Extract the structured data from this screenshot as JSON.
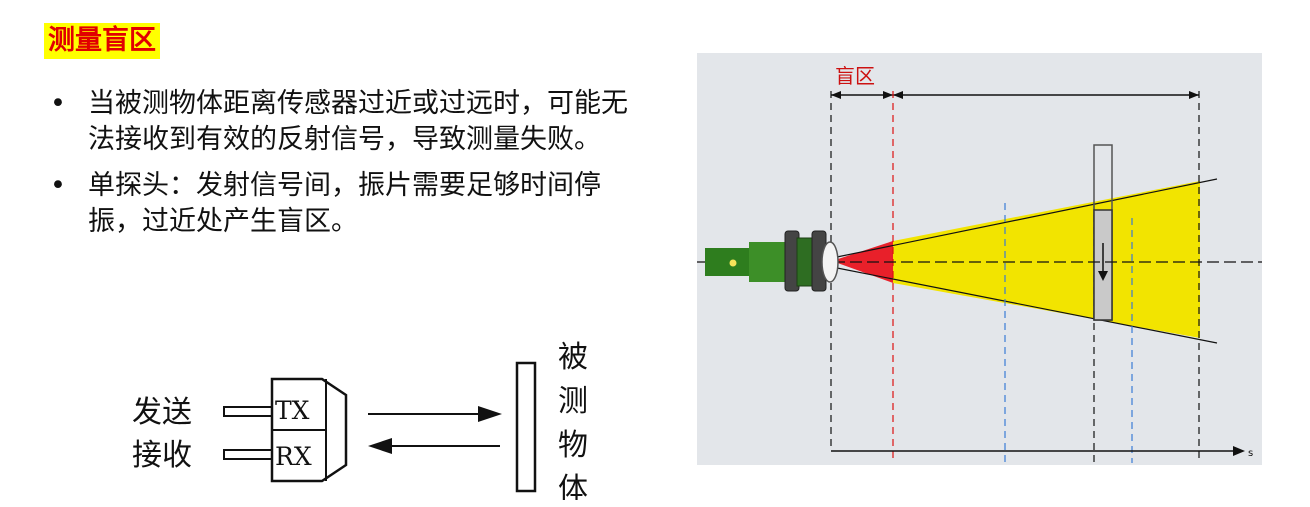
{
  "title": "测量盲区",
  "bullets": [
    "当被测物体距离传感器过近或过远时，可能无法接收到有效的反射信号，导致测量失败。",
    "单探头：发射信号间，振片需要足够时间停振，过近处产生盲区。"
  ],
  "schematic": {
    "send_label": "发送",
    "receive_label": "接收",
    "tx_label": "TX",
    "rx_label": "RX",
    "object_label": [
      "被",
      "测",
      "物",
      "体"
    ]
  },
  "figure": {
    "blind_zone_label": "盲区",
    "axis_label": "s",
    "colors": {
      "blind_zone": "#e8202a",
      "beam": "#f2e400",
      "background": "#e3e6ea",
      "sensor": "#2e7d1e"
    }
  }
}
